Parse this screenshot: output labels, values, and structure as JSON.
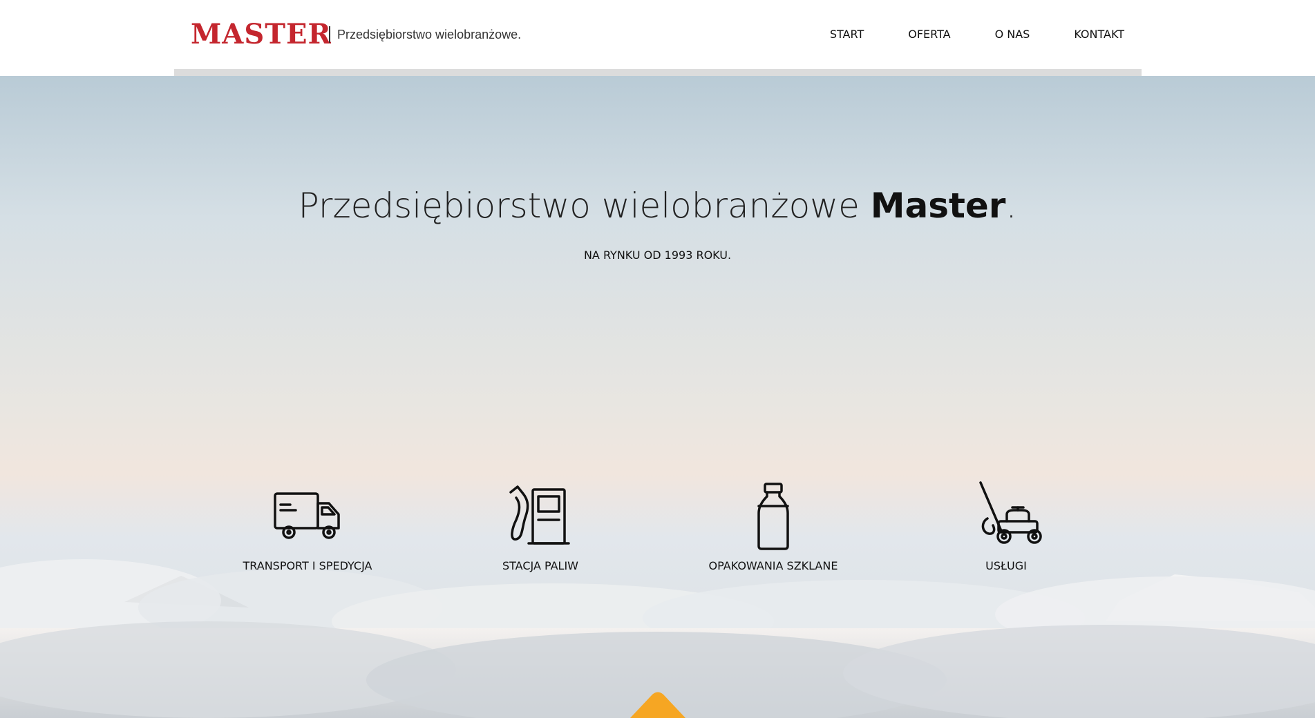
{
  "header": {
    "logo_text": "MASTER",
    "tagline": "Przedsiębiorstwo wielobranżowe.",
    "nav": [
      {
        "label": "START"
      },
      {
        "label": "OFERTA"
      },
      {
        "label": "O NAS"
      },
      {
        "label": "KONTAKT"
      }
    ]
  },
  "hero": {
    "title_light": "Przedsiębiorstwo wielobranżowe ",
    "title_bold": "Master",
    "title_end": ".",
    "subtitle": "NA RYNKU OD 1993 ROKU."
  },
  "services": [
    {
      "label": "TRANSPORT I SPEDYCJA",
      "icon": "truck-icon"
    },
    {
      "label": "STACJA PALIW",
      "icon": "fuel-pump-icon"
    },
    {
      "label": "OPAKOWANIA SZKLANE",
      "icon": "glass-bottle-icon"
    },
    {
      "label": "USŁUGI",
      "icon": "lawn-mower-icon"
    }
  ],
  "colors": {
    "brand_red": "#c4262e",
    "accent_orange": "#f6a623",
    "text": "#111111"
  }
}
